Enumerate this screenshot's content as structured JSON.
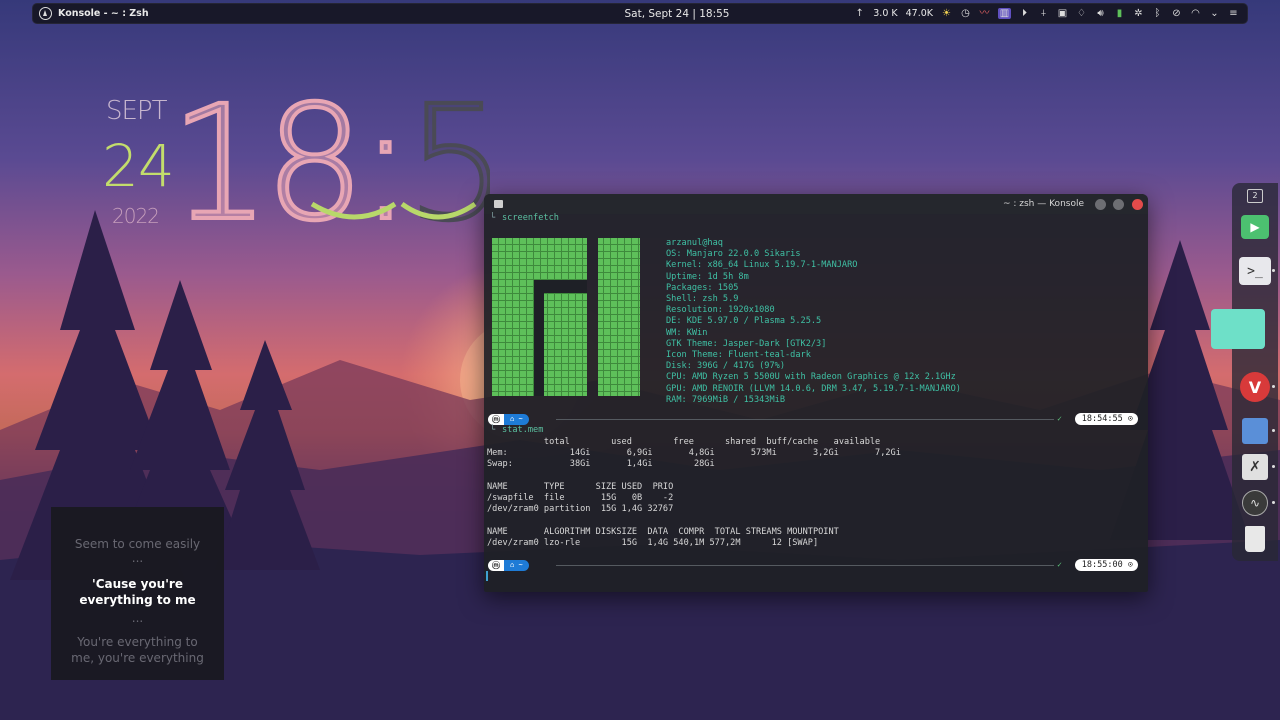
{
  "panel": {
    "app_title": "Konsole - ~ : Zsh",
    "clock": "Sat, Sept 24 | 18:55",
    "net_up": "3.0 K",
    "net_down": "47.0K",
    "workspace_number": "2"
  },
  "desktop_clock": {
    "month": "SEPT",
    "day": "24",
    "year": "2022",
    "time": "18:55"
  },
  "konsole": {
    "title": "~ : zsh — Konsole",
    "cmd1": "screenfetch",
    "fetch": {
      "user": "arzanul@haq",
      "os": "OS: Manjaro 22.0.0 Sikaris",
      "kernel": "Kernel: x86_64 Linux 5.19.7-1-MANJARO",
      "uptime": "Uptime: 1d 5h 8m",
      "packages": "Packages: 1505",
      "shell": "Shell: zsh 5.9",
      "resolution": "Resolution: 1920x1080",
      "de": "DE: KDE 5.97.0 / Plasma 5.25.5",
      "wm": "WM: KWin",
      "gtk": "GTK Theme: Jasper-Dark [GTK2/3]",
      "icons": "Icon Theme: Fluent-teal-dark",
      "disk": "Disk: 396G / 417G (97%)",
      "cpu": "CPU: AMD Ryzen 5 5500U with Radeon Graphics @ 12x 2.1GHz",
      "gpu": "GPU: AMD RENOIR (LLVM 14.0.6, DRM 3.47, 5.19.7-1-MANJARO)",
      "ram": "RAM: 7969MiB / 15343MiB"
    },
    "prompt1_time": "18:54:55",
    "cmd2": "stat.mem",
    "free_header": "           total        used        free      shared  buff/cache   available",
    "free_mem": "Mem:            14Gi       6,9Gi       4,8Gi       573Mi       3,2Gi       7,2Gi",
    "free_swap": "Swap:           38Gi       1,4Gi        28Gi",
    "swap_header": "NAME       TYPE      SIZE USED  PRIO",
    "swap_row1": "/swapfile  file       15G   0B    -2",
    "swap_row2": "/dev/zram0 partition  15G 1,4G 32767",
    "zram_header": "NAME       ALGORITHM DISKSIZE  DATA  COMPR  TOTAL STREAMS MOUNTPOINT",
    "zram_row": "/dev/zram0 lzo-rle        15G  1,4G 540,1M 577,2M      12 [SWAP]",
    "prompt2_time": "18:55:00",
    "prompt_home": "~"
  },
  "lyrics": {
    "prev": "Seem to come easily",
    "dots1": "...",
    "current1": "'Cause you're",
    "current2": "everything to me",
    "dots2": "...",
    "next1": "You're everything to",
    "next2": "me, you're everything"
  },
  "dock": {
    "items": [
      "media-player-icon",
      "terminal-icon",
      "folder-icon",
      "vivaldi-icon",
      "kate-icon",
      "office-icon",
      "obs-icon",
      "trash-icon"
    ]
  },
  "colors": {
    "accent_cyan": "#3fc0a4",
    "manjaro_green": "#5ec05a",
    "clock_green": "#b8d86a",
    "clock_pink": "#e8a6b4"
  }
}
